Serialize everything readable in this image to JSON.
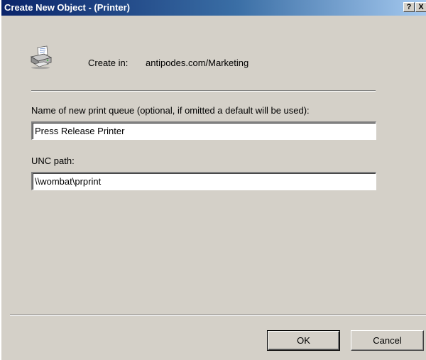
{
  "window": {
    "title": "Create New Object - (Printer)",
    "help_button": "?",
    "close_button": "X"
  },
  "header": {
    "icon": "printer-icon",
    "create_in_label": "Create in:",
    "create_in_value": "antipodes.com/Marketing"
  },
  "form": {
    "queue_name_label": "Name of new print queue (optional, if omitted a default will be used):",
    "queue_name_value": "Press Release Printer",
    "unc_path_label": "UNC path:",
    "unc_path_value": "\\\\wombat\\prprint"
  },
  "buttons": {
    "ok_label": "OK",
    "cancel_label": "Cancel"
  },
  "colors": {
    "titlebar_start": "#0a246a",
    "titlebar_end": "#a6caf0",
    "dialog_face": "#d4d0c8"
  }
}
